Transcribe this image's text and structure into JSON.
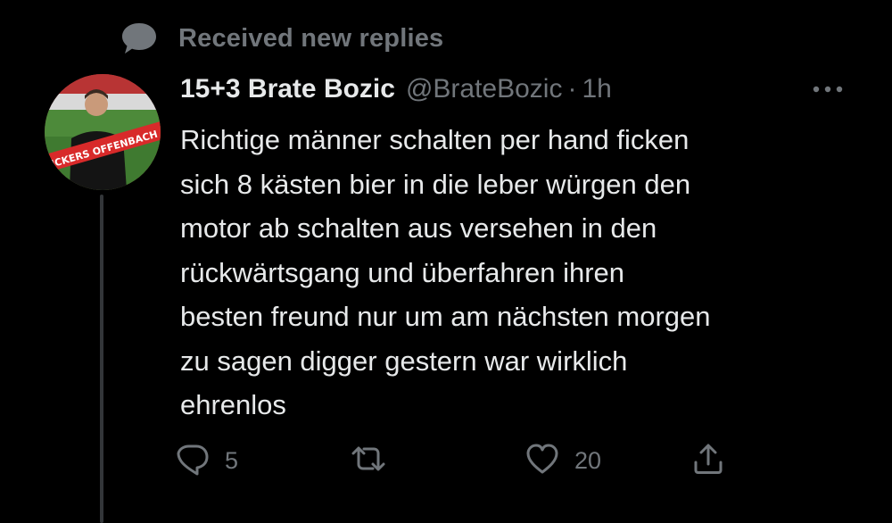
{
  "notice": {
    "text": "Received new replies",
    "icon": "speech-bubble-icon"
  },
  "tweet": {
    "display_name": "15+3 Brate Bozic",
    "handle": "@BrateBozic",
    "separator": "·",
    "time": "1h",
    "text": "Richtige männer schalten per hand ficken\nsich 8 kästen bier in die leber würgen den\nmotor ab schalten aus versehen in den\nrückwärtsgang und überfahren ihren\nbesten freund nur um am nächsten morgen\nzu sagen digger gestern war wirklich\nehrenlos",
    "avatar_scarf_text": "KICKERS OFFENBACH",
    "replies": "5",
    "likes": "20"
  },
  "colors": {
    "background": "#000000",
    "primary_text": "#e7e9ea",
    "secondary_text": "#71767b",
    "thread_line": "#333639"
  }
}
